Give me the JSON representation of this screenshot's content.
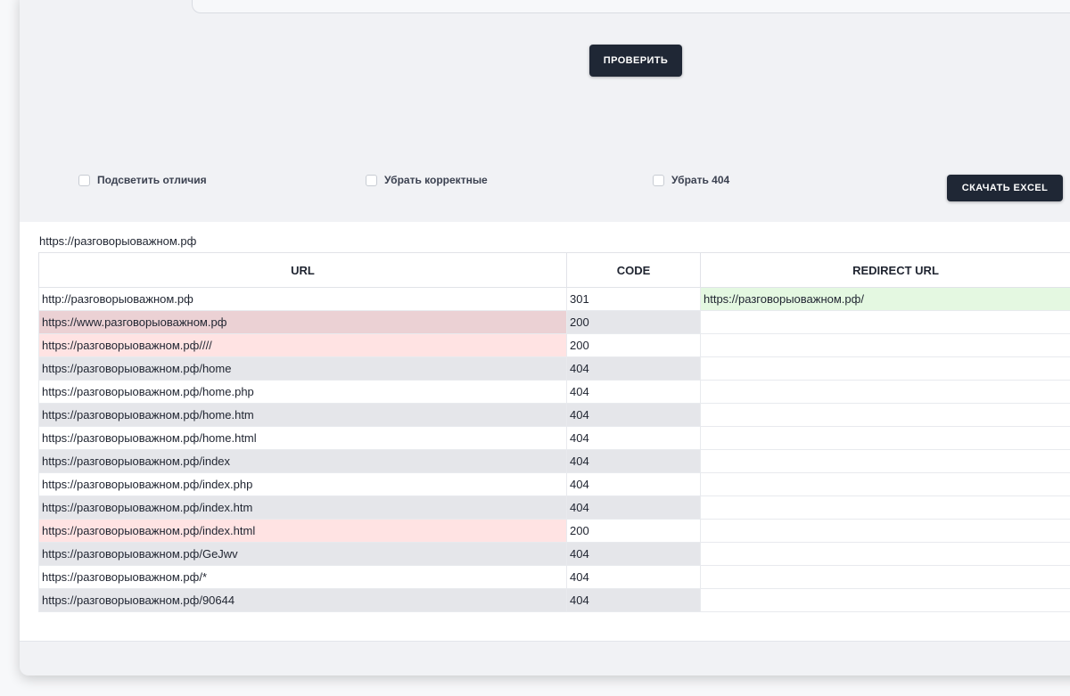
{
  "toolbar": {
    "check_label": "ПРОВЕРИТЬ",
    "excel_label": "СКАЧАТЬ EXCEL"
  },
  "options": [
    {
      "label": "Подсветить отличия",
      "checked": false
    },
    {
      "label": "Убрать корректные",
      "checked": false
    },
    {
      "label": "Убрать 404",
      "checked": false
    }
  ],
  "results": {
    "domain": "https://разговорыоважном.рф",
    "columns": [
      "URL",
      "CODE",
      "REDIRECT URL"
    ],
    "rows": [
      {
        "url": "http://разговорыоважном.рф",
        "code": "301",
        "redirect": "https://разговорыоважном.рф/"
      },
      {
        "url": "https://www.разговорыоважном.рф",
        "code": "200",
        "redirect": ""
      },
      {
        "url": "https://разговорыоважном.рф////",
        "code": "200",
        "redirect": ""
      },
      {
        "url": "https://разговорыоважном.рф/home",
        "code": "404",
        "redirect": ""
      },
      {
        "url": "https://разговорыоважном.рф/home.php",
        "code": "404",
        "redirect": ""
      },
      {
        "url": "https://разговорыоважном.рф/home.htm",
        "code": "404",
        "redirect": ""
      },
      {
        "url": "https://разговорыоважном.рф/home.html",
        "code": "404",
        "redirect": ""
      },
      {
        "url": "https://разговорыоважном.рф/index",
        "code": "404",
        "redirect": ""
      },
      {
        "url": "https://разговорыоважном.рф/index.php",
        "code": "404",
        "redirect": ""
      },
      {
        "url": "https://разговорыоважном.рф/index.htm",
        "code": "404",
        "redirect": ""
      },
      {
        "url": "https://разговорыоважном.рф/index.html",
        "code": "200",
        "redirect": ""
      },
      {
        "url": "https://разговорыоважном.рф/GeJwv",
        "code": "404",
        "redirect": ""
      },
      {
        "url": "https://разговорыоважном.рф/*",
        "code": "404",
        "redirect": ""
      },
      {
        "url": "https://разговорыоважном.рф/90644",
        "code": "404",
        "redirect": ""
      }
    ]
  }
}
